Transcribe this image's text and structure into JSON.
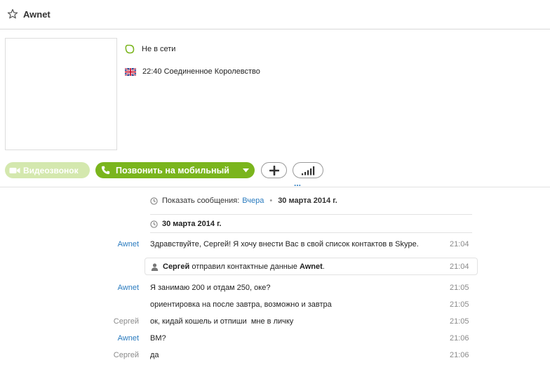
{
  "header": {
    "title": "Awnet",
    "favorite_icon": "star-outline-icon"
  },
  "profile": {
    "status": "Не в сети",
    "status_color": "#7ab51d",
    "local_time": "22:40 Соединенное Королевство",
    "country_flag": "uk-flag-icon"
  },
  "actions": {
    "video_call": "Видеозвонок",
    "call_mobile": "Позвонить на мобильный",
    "add_icon": "plus-icon",
    "signal_icon": "signal-bars-icon",
    "more": "...",
    "colors": {
      "call": "#7ab51d",
      "video_disabled": "#d4e8ae"
    }
  },
  "history": {
    "label": "Показать сообщения:",
    "link": "Вчера",
    "separator": "•",
    "date": "30 марта 2014 г."
  },
  "date_heading": "30 марта 2014 г.",
  "messages": [
    {
      "sender": "Awnet",
      "text": "Здравствуйте, Сергей! Я хочу внести Вас в свой список контактов в Skype.",
      "time": "21:04"
    },
    {
      "system": true,
      "user": "Сергей",
      "action": "отправил контактные данные",
      "contact": "Awnet",
      "end": ".",
      "time": "21:04"
    },
    {
      "sender": "Awnet",
      "text": "Я занимаю 200 и отдам 250, оке?",
      "time": "21:05"
    },
    {
      "sender": "",
      "text": "ориентировка на после завтра, возможно и завтра",
      "time": "21:05"
    },
    {
      "sender": "Сергей",
      "text": "ок, кидай кошель и отпиши  мне в личку",
      "time": "21:05"
    },
    {
      "sender": "Awnet",
      "text": "ВМ?",
      "time": "21:06"
    },
    {
      "sender": "Сергей",
      "text": "да",
      "time": "21:06"
    }
  ]
}
